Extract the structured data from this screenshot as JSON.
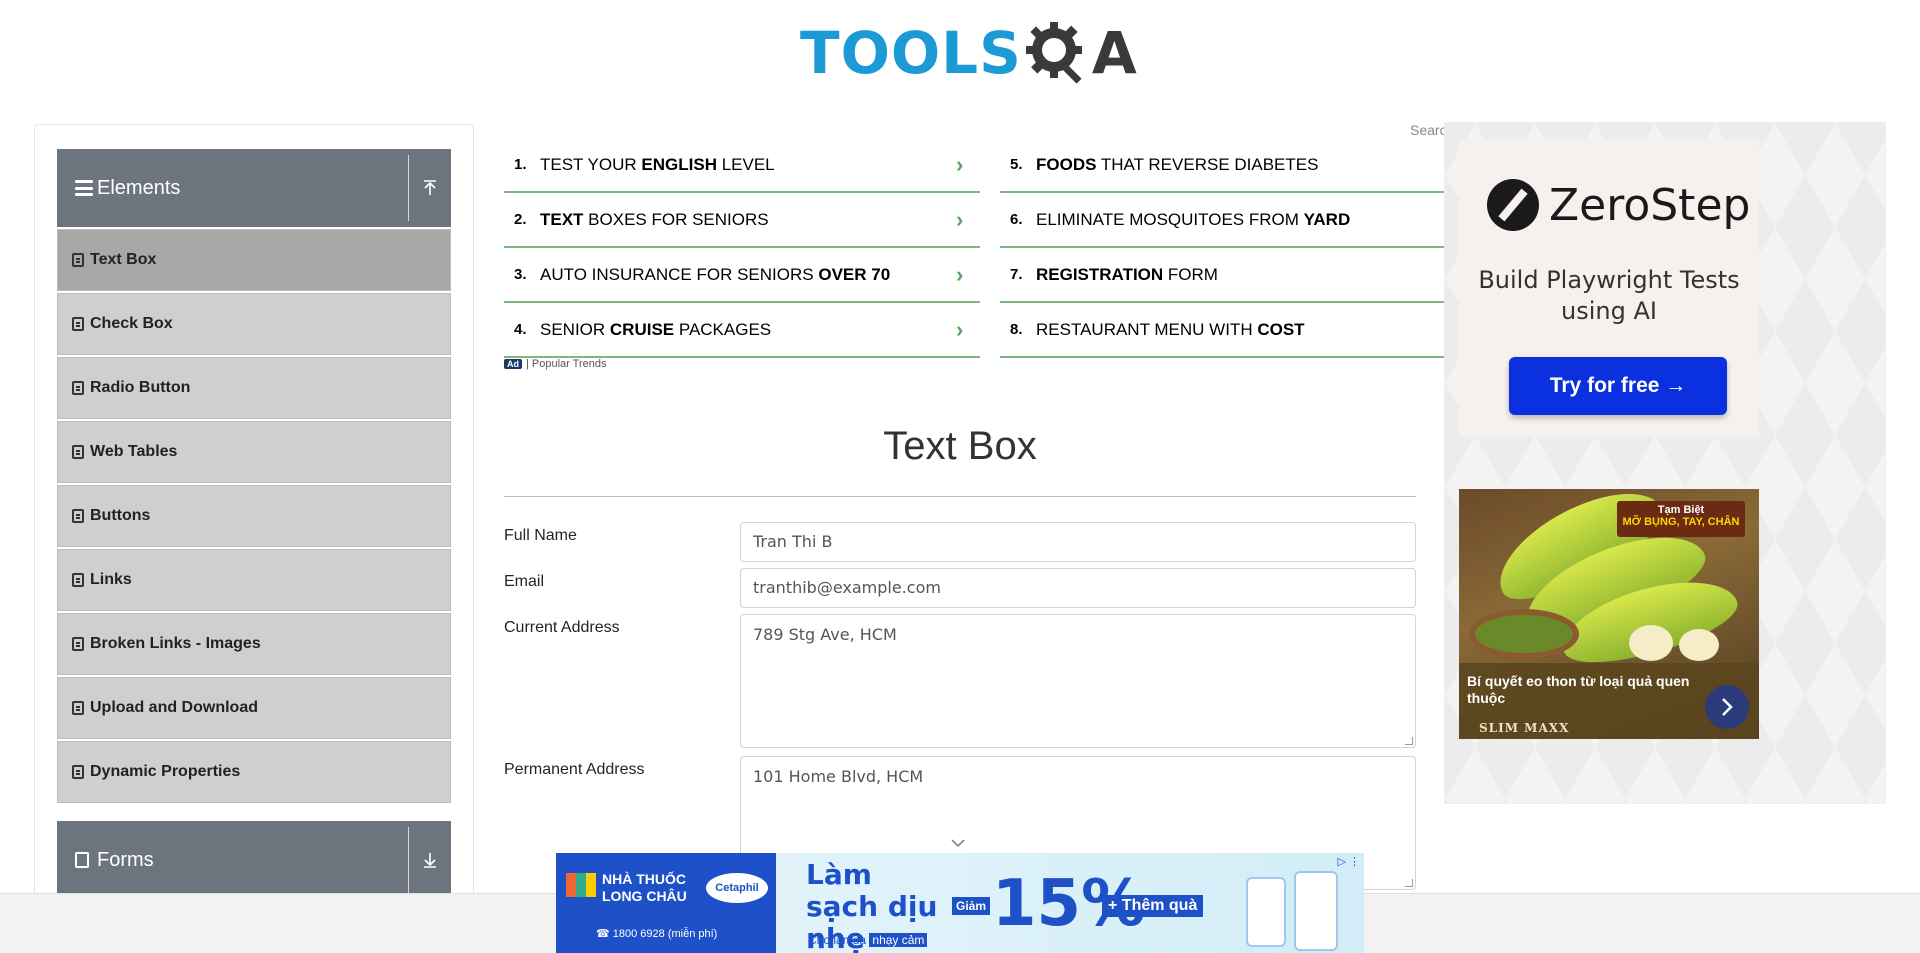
{
  "header": {
    "logo_text_left": "TOOLS",
    "logo_text_right": "A"
  },
  "sidebar": {
    "elements_group": {
      "label": "Elements",
      "toggle_icon": "upload-arrow-icon"
    },
    "items": [
      {
        "label": "Text Box",
        "active": true
      },
      {
        "label": "Check Box",
        "active": false
      },
      {
        "label": "Radio Button",
        "active": false
      },
      {
        "label": "Web Tables",
        "active": false
      },
      {
        "label": "Buttons",
        "active": false
      },
      {
        "label": "Links",
        "active": false
      },
      {
        "label": "Broken Links - Images",
        "active": false
      },
      {
        "label": "Upload and Download",
        "active": false
      },
      {
        "label": "Dynamic Properties",
        "active": false
      }
    ],
    "forms_group": {
      "label": "Forms",
      "toggle_icon": "download-arrow-icon"
    }
  },
  "ads": {
    "left_column": [
      {
        "num": "1.",
        "pre": "TEST YOUR ",
        "bold": "ENGLISH",
        "post": " LEVEL"
      },
      {
        "num": "2.",
        "pre": "",
        "bold": "TEXT",
        "post": " BOXES FOR SENIORS"
      },
      {
        "num": "3.",
        "pre": "AUTO INSURANCE FOR SENIORS ",
        "bold": "OVER 70",
        "post": ""
      },
      {
        "num": "4.",
        "pre": "SENIOR ",
        "bold": "CRUISE",
        "post": " PACKAGES"
      }
    ],
    "right_column": [
      {
        "num": "5.",
        "pre": "",
        "bold": "FOODS",
        "post": " THAT REVERSE DIABETES"
      },
      {
        "num": "6.",
        "pre": "ELIMINATE MOSQUITOES FROM ",
        "bold": "YARD",
        "post": ""
      },
      {
        "num": "7.",
        "pre": "",
        "bold": "REGISTRATION",
        "post": " FORM"
      },
      {
        "num": "8.",
        "pre": "RESTAURANT MENU WITH ",
        "bold": "COST",
        "post": ""
      }
    ],
    "footer_badge": "Ad",
    "footer_text": "| Popular Trends",
    "search_partial": "Search"
  },
  "form": {
    "title": "Text Box",
    "full_name_label": "Full Name",
    "full_name_value": "Tran Thi B",
    "email_label": "Email",
    "email_value": "tranthib@example.com",
    "current_address_label": "Current Address",
    "current_address_value": "789 Stg Ave, HCM",
    "permanent_address_label": "Permanent Address",
    "permanent_address_value": "101 Home Blvd, HCM"
  },
  "right_ad": {
    "brand": "ZeroStep",
    "tagline": "Build Playwright Tests using AI",
    "cta": "Try for free →",
    "slim_badge_line1": "Tạm Biệt",
    "slim_badge_line2": "MỠ BỤNG, TAY, CHÂN",
    "slim_caption": "Bí quyết eo thon từ loại quả quen thuộc",
    "slim_brand": "SLIM MAXX"
  },
  "bottom_banner": {
    "store_name": "NHÀ THUỐC LONG CHÂU",
    "phone": "1800 6928 (miễn phí)",
    "partner": "Cetaphil",
    "headline": "Làm sạch dịu nhẹ",
    "sub_prefix": "Cho làn da ",
    "sub_highlight": "nhạy cảm",
    "discount_label": "Giảm",
    "discount_value": "15%",
    "extra": "+ Thêm quà"
  },
  "colors": {
    "accent_blue": "#1c9ad6",
    "sidebar_header": "#6c757d",
    "sidebar_item": "#cfcfcf",
    "sidebar_item_active": "#a8a8a8",
    "ad_rule": "#7cb77c",
    "cta_blue": "#0a30e0"
  }
}
